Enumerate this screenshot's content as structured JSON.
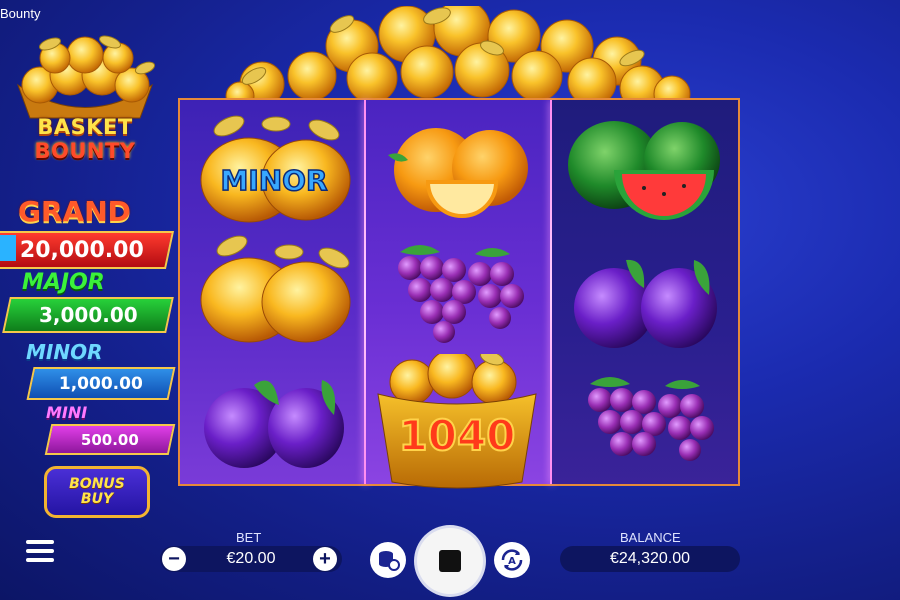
{
  "window_title": "Bounty",
  "logo": {
    "line1": "BASKET",
    "line2": "BOUNTY"
  },
  "jackpots": {
    "grand": {
      "label": "GRAND",
      "value": "20,000.00",
      "color": "#ff3b2e"
    },
    "major": {
      "label": "MAJOR",
      "value": "3,000.00",
      "color": "#27d13a"
    },
    "minor": {
      "label": "MINOR",
      "value": "1,000.00",
      "color": "#2f8fe8"
    },
    "mini": {
      "label": "MINI",
      "value": "500.00",
      "color": "#e13fe8"
    }
  },
  "bonus_buy": {
    "line1": "BONUS",
    "line2": "BUY"
  },
  "reels": {
    "columns": [
      [
        "golden-apples-minor",
        "golden-apples",
        "plums"
      ],
      [
        "oranges",
        "grapes",
        "golden-basket-1040"
      ],
      [
        "watermelons",
        "plums",
        "grapes"
      ]
    ],
    "minor_badge": "MINOR",
    "basket_value": "1040"
  },
  "bottom_bar": {
    "bet_label": "BET",
    "bet_value": "€20.00",
    "balance_label": "BALANCE",
    "balance_value": "€24,320.00",
    "icons": [
      "menu-icon",
      "minus-icon",
      "plus-icon",
      "settings-icon",
      "stop-icon",
      "autoplay-icon"
    ]
  },
  "colors": {
    "frame": "#e68a3a",
    "gold": "#f5b321",
    "background": "#1b2bb0"
  }
}
